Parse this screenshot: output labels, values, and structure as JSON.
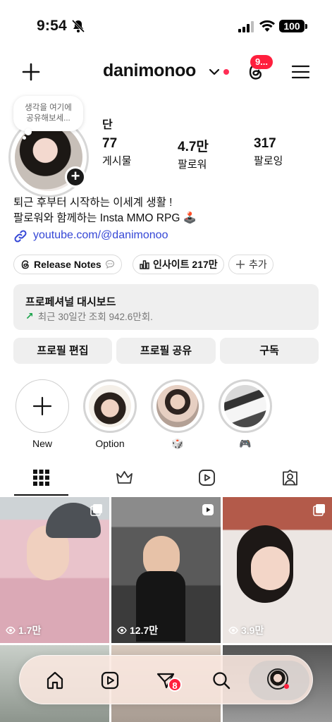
{
  "status": {
    "time": "9:54",
    "battery": "100"
  },
  "header": {
    "username": "danimonoo",
    "threads_badge": "9..."
  },
  "profile": {
    "note_line1": "생각을 여기에",
    "note_line2": "공유해보세...",
    "display_name": "단",
    "stats": [
      {
        "value": "77",
        "label": "게시물"
      },
      {
        "value": "4.7만",
        "label": "팔로워"
      },
      {
        "value": "317",
        "label": "팔로잉"
      }
    ],
    "bio_line1": "퇴근 후부터 시작하는 이세계 생활 !",
    "bio_line2": "팔로워와 함께하는 Insta MMO RPG 🕹️",
    "link": "youtube.com/@danimonoo"
  },
  "chips": {
    "release_notes": "Release Notes",
    "insights": "인사이트 217만",
    "add": "추가"
  },
  "dashboard": {
    "title": "프로페셔널 대시보드",
    "subtitle": "최근 30일간 조회 942.6만회."
  },
  "buttons": {
    "edit_profile": "프로필 편집",
    "share_profile": "프로필 공유",
    "subscribe": "구독"
  },
  "highlights": [
    {
      "label": "New"
    },
    {
      "label": "Option"
    },
    {
      "label": "🎲"
    },
    {
      "label": "🎮"
    }
  ],
  "posts": [
    {
      "views": "1.7만"
    },
    {
      "views": "12.7만"
    },
    {
      "views": "3.9만"
    }
  ],
  "nav": {
    "messages_badge": "8"
  },
  "colors": {
    "accent_red": "#ff1f3d",
    "link_blue": "#3547d6",
    "growth_green": "#1aa34a"
  }
}
